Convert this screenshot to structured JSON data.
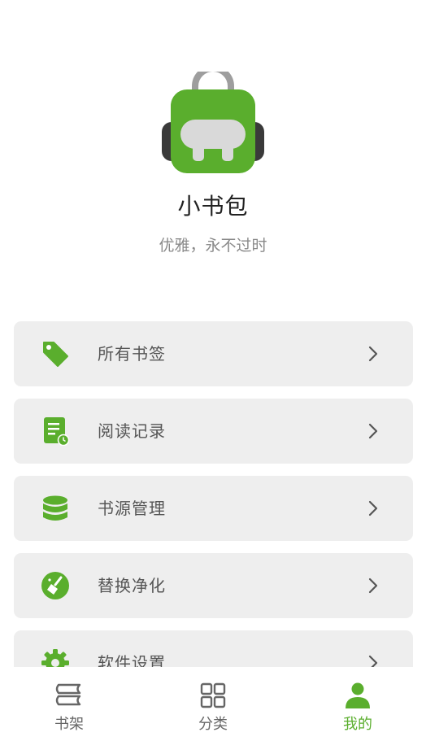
{
  "profile": {
    "app_name": "小书包",
    "slogan": "优雅，永不过时"
  },
  "menu": {
    "items": [
      {
        "label": "所有书签",
        "icon": "tag-icon"
      },
      {
        "label": "阅读记录",
        "icon": "reading-history-icon"
      },
      {
        "label": "书源管理",
        "icon": "database-icon"
      },
      {
        "label": "替换净化",
        "icon": "broom-icon"
      },
      {
        "label": "软件设置",
        "icon": "gear-icon"
      }
    ]
  },
  "tabbar": {
    "tabs": [
      {
        "label": "书架",
        "icon": "bookshelf-icon"
      },
      {
        "label": "分类",
        "icon": "category-grid-icon"
      },
      {
        "label": "我的",
        "icon": "person-icon",
        "active": true
      }
    ]
  },
  "colors": {
    "accent": "#5aae2d",
    "card_bg": "#eeeeee",
    "label_text": "#555555"
  }
}
